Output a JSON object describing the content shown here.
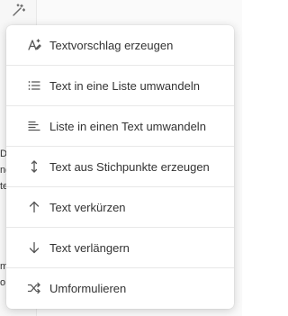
{
  "toolbar": {
    "magic_button_icon": "magic-wand-icon"
  },
  "background_text": {
    "fragments": [
      "Du",
      "ng",
      "te",
      "m",
      "o"
    ]
  },
  "menu": {
    "items": [
      {
        "label": "Textvorschlag erzeugen",
        "icon": "text-suggestion-icon"
      },
      {
        "label": "Text in eine Liste umwandeln",
        "icon": "list-icon"
      },
      {
        "label": "Liste in einen Text umwandeln",
        "icon": "align-left-icon"
      },
      {
        "label": "Text aus Stichpunkte erzeugen",
        "icon": "expand-vertical-icon"
      },
      {
        "label": "Text verkürzen",
        "icon": "arrow-up-icon"
      },
      {
        "label": "Text verlängern",
        "icon": "arrow-down-icon"
      },
      {
        "label": "Umformulieren",
        "icon": "shuffle-icon"
      }
    ]
  }
}
